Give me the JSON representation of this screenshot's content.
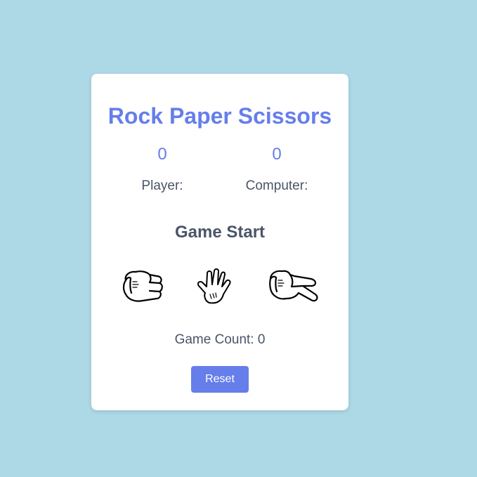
{
  "game": {
    "title": "Rock Paper Scissors",
    "status": "Game Start",
    "reset_label": "Reset",
    "game_count_label": "Game Count: 0"
  },
  "scores": {
    "player": {
      "value": "0",
      "label": "Player:"
    },
    "computer": {
      "value": "0",
      "label": "Computer:"
    }
  },
  "choices": [
    {
      "name": "rock",
      "icon": "rock-hand-icon"
    },
    {
      "name": "paper",
      "icon": "paper-hand-icon"
    },
    {
      "name": "scissors",
      "icon": "scissors-hand-icon"
    }
  ],
  "colors": {
    "background": "#add8e6",
    "accent": "#667eea",
    "text": "#4a5568",
    "card": "#ffffff"
  }
}
